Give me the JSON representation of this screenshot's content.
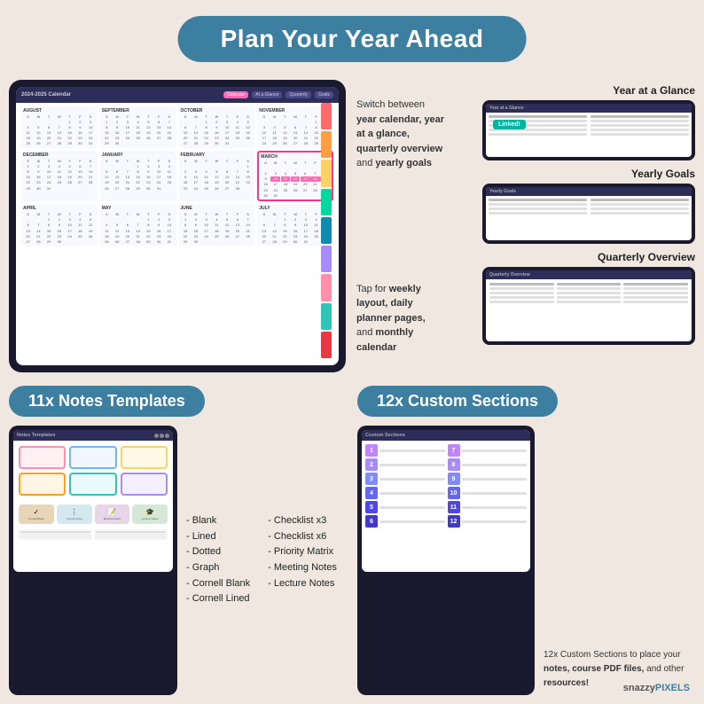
{
  "header": {
    "title": "Plan Your Year Ahead"
  },
  "top_section": {
    "annotation1": {
      "text_before": "Switch between",
      "bold_text": "year calendar, year at a glance, quarterly overview",
      "text_after": "and",
      "bold_text2": "yearly goals"
    },
    "annotation2": {
      "text_before": "Tap for",
      "bold_text": "weekly layout, daily planner pages,",
      "text_after": "and",
      "bold_text2": "monthly calendar"
    },
    "calendar": {
      "title": "2024-2025 Calendar",
      "tabs": [
        "Calendar",
        "At a Glance",
        "Quarterly",
        "Goals"
      ]
    },
    "right_labels": [
      "Year at a Glance",
      "Yearly Goals",
      "Quarterly Overview"
    ],
    "linked_badge": "Linked!"
  },
  "notes_section": {
    "banner": "11x Notes Templates",
    "items_col1": [
      "Blank",
      "Lined",
      "Dotted",
      "Graph",
      "Cornell Blank",
      "Cornell Lined"
    ],
    "items_col2": [
      "Checklist x3",
      "Checklist x6",
      "Priority Matrix",
      "Meeting Notes",
      "Lecture Notes"
    ]
  },
  "custom_section": {
    "banner": "12x Custom Sections",
    "numbers_left": [
      "1",
      "2",
      "3",
      "4",
      "5",
      "6"
    ],
    "numbers_right": [
      "7",
      "8",
      "9",
      "10",
      "11",
      "12"
    ],
    "description": "12x Custom Sections to place your",
    "bold1": "notes, course PDF files,",
    "text2": "and other",
    "bold2": "resources!"
  },
  "logo": {
    "part1": "snazzy",
    "part2": "PIXELS"
  },
  "colors": {
    "strip": [
      "#ff6b6b",
      "#ff9f43",
      "#ffd166",
      "#06d6a0",
      "#118ab2",
      "#a78bfa",
      "#ff8fab",
      "#2ec4b6",
      "#e63946"
    ],
    "badge_left": [
      "#c084fc",
      "#a78bfa",
      "#818cf8",
      "#6366f1",
      "#4f46e5",
      "#4338ca"
    ],
    "badge_right": [
      "#c084fc",
      "#a78bfa",
      "#818cf8",
      "#6366f1",
      "#4f46e5",
      "#4338ca"
    ]
  }
}
